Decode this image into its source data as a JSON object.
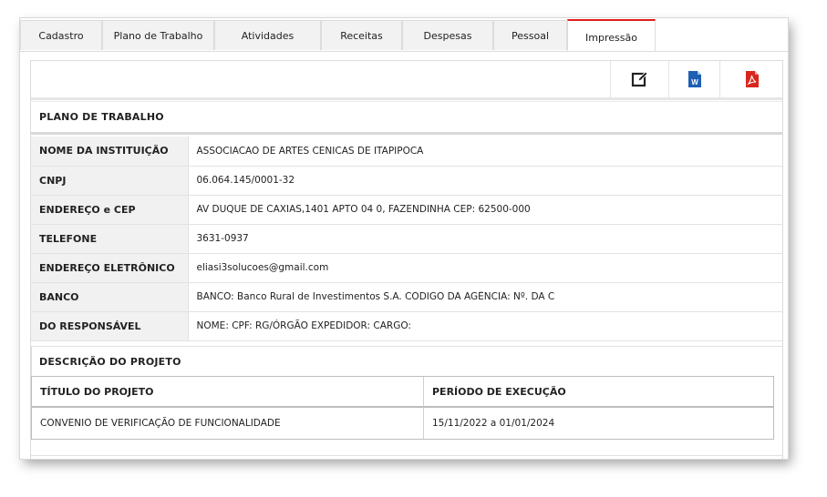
{
  "tabs": [
    {
      "label": "Cadastro",
      "active": false
    },
    {
      "label": "Plano de Trabalho",
      "active": false
    },
    {
      "label": "Atividades",
      "active": false
    },
    {
      "label": "Receitas",
      "active": false
    },
    {
      "label": "Despesas",
      "active": false
    },
    {
      "label": "Pessoal",
      "active": false
    },
    {
      "label": "Impressão",
      "active": true
    }
  ],
  "toolbar": {
    "icons": [
      "edit-icon",
      "word-document-icon",
      "pdf-document-icon"
    ],
    "word_glyph": "W",
    "colors": {
      "edit": "#222222",
      "word": "#1e5fb4",
      "pdf": "#d9261c"
    }
  },
  "plano": {
    "title": "PLANO DE TRABALHO",
    "rows": [
      {
        "label": "NOME DA INSTITUIÇÃO",
        "value": "ASSOCIACAO DE ARTES CENICAS DE ITAPIPOCA"
      },
      {
        "label": "CNPJ",
        "value": "06.064.145/0001-32"
      },
      {
        "label": "ENDEREÇO e CEP",
        "value": "AV DUQUE DE CAXIAS,1401 APTO 04 0, FAZENDINHA CEP: 62500-000"
      },
      {
        "label": "TELEFONE",
        "value": "3631-0937"
      },
      {
        "label": "ENDEREÇO ELETRÔNICO",
        "value": "eliasi3solucoes@gmail.com"
      },
      {
        "label": "BANCO",
        "value": "BANCO: Banco Rural de Investimentos S.A. CÓDIGO DA AGÊNCIA: Nº. DA C"
      },
      {
        "label": "DO RESPONSÁVEL",
        "value": "NOME: CPF: RG/ÓRGÃO EXPEDIDOR: CARGO:"
      }
    ]
  },
  "descricao": {
    "title": "DESCRIÇÃO DO PROJETO",
    "headers": {
      "titulo": "TÍTULO DO PROJETO",
      "periodo": "PERÍODO DE EXECUÇÃO"
    },
    "row": {
      "titulo": "CONVENIO DE VERIFICAÇÃO DE FUNCIONALIDADE",
      "periodo": "15/11/2022 a 01/01/2024"
    }
  }
}
